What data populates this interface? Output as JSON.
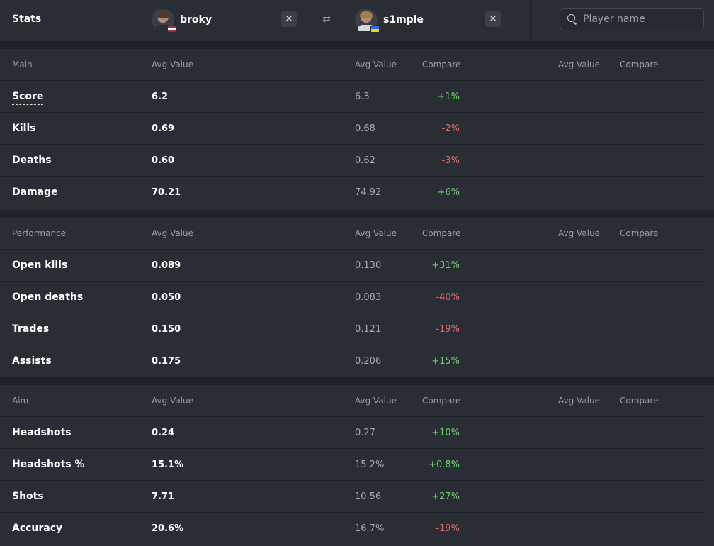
{
  "header": {
    "title": "Stats",
    "player1": {
      "name": "broky",
      "flag": "Latvia"
    },
    "player2": {
      "name": "s1mple",
      "flag": "Ukraine"
    },
    "search": {
      "placeholder": "Player name",
      "value": ""
    }
  },
  "columns": {
    "avg_value": "Avg Value",
    "compare": "Compare"
  },
  "colors": {
    "positive": "#6fcf6f",
    "negative": "#e86a6a",
    "background": "#292e35"
  },
  "sections": [
    {
      "title": "Main",
      "rows": [
        {
          "label": "Score",
          "p1": "6.2",
          "p2": "6.3",
          "compare": "+1%"
        },
        {
          "label": "Kills",
          "p1": "0.69",
          "p2": "0.68",
          "compare": "-2%"
        },
        {
          "label": "Deaths",
          "p1": "0.60",
          "p2": "0.62",
          "compare": "-3%"
        },
        {
          "label": "Damage",
          "p1": "70.21",
          "p2": "74.92",
          "compare": "+6%"
        }
      ]
    },
    {
      "title": "Performance",
      "rows": [
        {
          "label": "Open kills",
          "p1": "0.089",
          "p2": "0.130",
          "compare": "+31%"
        },
        {
          "label": "Open deaths",
          "p1": "0.050",
          "p2": "0.083",
          "compare": "-40%"
        },
        {
          "label": "Trades",
          "p1": "0.150",
          "p2": "0.121",
          "compare": "-19%"
        },
        {
          "label": "Assists",
          "p1": "0.175",
          "p2": "0.206",
          "compare": "+15%"
        }
      ]
    },
    {
      "title": "Aim",
      "rows": [
        {
          "label": "Headshots",
          "p1": "0.24",
          "p2": "0.27",
          "compare": "+10%"
        },
        {
          "label": "Headshots %",
          "p1": "15.1%",
          "p2": "15.2%",
          "compare": "+0.8%"
        },
        {
          "label": "Shots",
          "p1": "7.71",
          "p2": "10.56",
          "compare": "+27%"
        },
        {
          "label": "Accuracy",
          "p1": "20.6%",
          "p2": "16.7%",
          "compare": "-19%"
        }
      ]
    }
  ]
}
